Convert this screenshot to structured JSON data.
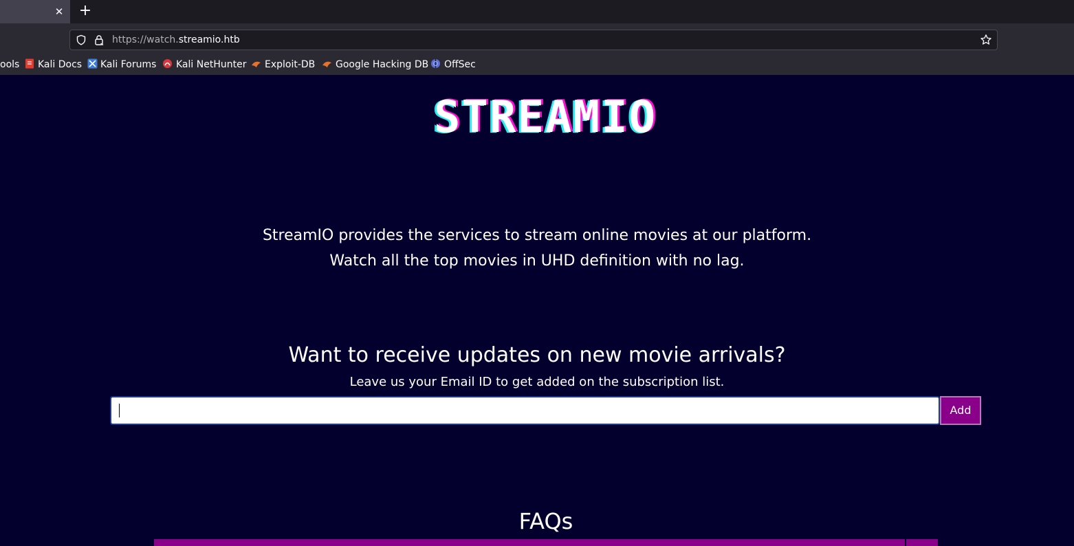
{
  "browser": {
    "url_scheme": "https://watch.",
    "url_host": "streamio.htb",
    "bookmarks": [
      {
        "label": "ools",
        "icon": "tools-icon"
      },
      {
        "label": "Kali Docs",
        "icon": "kali-docs-icon",
        "color": "#e33b2e"
      },
      {
        "label": "Kali Forums",
        "icon": "kali-forums-icon",
        "color": "#3b7ddd"
      },
      {
        "label": "Kali NetHunter",
        "icon": "kali-nethunter-icon",
        "color": "#d9363e"
      },
      {
        "label": "Exploit-DB",
        "icon": "exploit-db-icon",
        "color": "#e8722b"
      },
      {
        "label": "Google Hacking DB",
        "icon": "ghdb-icon",
        "color": "#e8722b"
      },
      {
        "label": "OffSec",
        "icon": "offsec-icon",
        "color": "#5b6fd6"
      }
    ]
  },
  "site": {
    "logo": "STREAMIO",
    "intro_line1": "StreamIO provides the services to stream online movies at our platform.",
    "intro_line2": "Watch all the top movies in UHD definition with no lag.",
    "updates_title": "Want to receive updates on new movie arrivals?",
    "updates_sub": "Leave us your Email ID to get added on the subscription list.",
    "email_value": "",
    "add_label": "Add",
    "faq_title": "FAQs"
  },
  "colors": {
    "page_bg": "#03002e",
    "accent": "#8b008b",
    "logo_cyan": "#22f0f0",
    "logo_magenta": "#ff10d0"
  }
}
